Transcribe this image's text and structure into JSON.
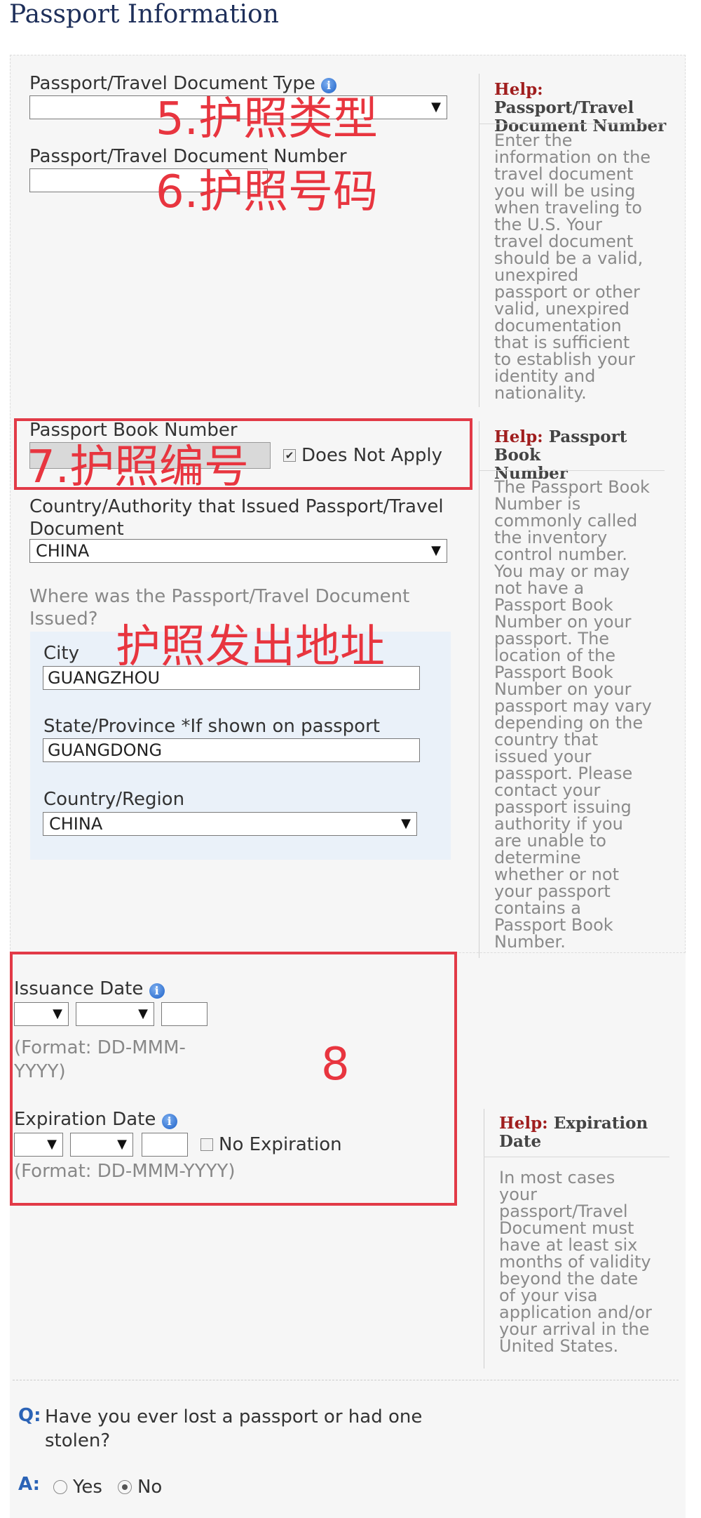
{
  "page": {
    "section_title": "Passport Information"
  },
  "fields": {
    "doc_type": {
      "label": "Passport/Travel Document Type",
      "value": ""
    },
    "doc_number": {
      "label": "Passport/Travel Document Number",
      "value": ""
    },
    "book_number": {
      "label": "Passport Book Number",
      "value": "",
      "does_not_apply_label": "Does Not Apply",
      "does_not_apply_checked": true
    },
    "issuing_country": {
      "label_line1": "Country/Authority that Issued Passport/Travel",
      "label_line2": "Document",
      "value": "CHINA"
    },
    "issued_where": {
      "question_line1": "Where was the Passport/Travel Document",
      "question_line2": "Issued?",
      "city": {
        "label": "City",
        "value": "GUANGZHOU"
      },
      "state": {
        "label": "State/Province *If shown on passport",
        "value": "GUANGDONG"
      },
      "country": {
        "label": "Country/Region",
        "value": "CHINA"
      }
    },
    "issuance_date": {
      "label": "Issuance Date",
      "format_line1": "(Format: DD-MMM-",
      "format_line2": "YYYY)"
    },
    "expiration_date": {
      "label": "Expiration Date",
      "format": "(Format: DD-MMM-YYYY)",
      "no_expiration_label": "No Expiration",
      "no_expiration_checked": false
    }
  },
  "help": {
    "doc_number": {
      "prefix": "Help:",
      "title_line1": "Passport/Travel",
      "title_line2": "Document Number",
      "body": [
        "Enter the",
        "information on the",
        "travel document",
        "you will be using",
        "when traveling to",
        "the U.S. Your",
        "travel document",
        "should be a valid,",
        "unexpired",
        "passport or other",
        "valid, unexpired",
        "documentation",
        "that is sufficient",
        "to establish your",
        "identity and",
        "nationality."
      ]
    },
    "book_number": {
      "prefix": "Help:",
      "title_line1": "Passport Book",
      "title_line2": "Number",
      "body": [
        "The Passport Book",
        "Number is",
        "commonly called",
        "the inventory",
        "control number.",
        "You may or may",
        "not have a",
        "Passport Book",
        "Number on your",
        "passport. The",
        "location of the",
        "Passport Book",
        "Number on your",
        "passport may vary",
        "depending on the",
        "country that",
        "issued your",
        "passport. Please",
        "contact your",
        "passport issuing",
        "authority if you",
        "are unable to",
        "determine",
        "whether or not",
        "your passport",
        "contains a",
        "Passport Book",
        "Number."
      ]
    },
    "expiration": {
      "prefix": "Help:",
      "title_line1": "Expiration",
      "title_line2": "Date",
      "body": [
        "In most cases",
        "your",
        "passport/Travel",
        "Document must",
        "have at least six",
        "months of validity",
        "beyond the date",
        "of your visa",
        "application and/or",
        "your arrival in the",
        "United States."
      ]
    }
  },
  "question": {
    "q_marker": "Q:",
    "text_line1": "Have you ever lost a passport or had one",
    "text_line2": "stolen?",
    "a_marker": "A:",
    "yes_label": "Yes",
    "no_label": "No",
    "selected": "No"
  },
  "annotations": {
    "a5": "5.护照类型",
    "a6": "6.护照号码",
    "a7": "7.护照编号",
    "issued_place": "护照发出地址",
    "a8": "8"
  },
  "icons": {
    "info": "info-icon",
    "dropdown": "chevron-down-icon"
  },
  "colors": {
    "annotation_red": "#e8353f",
    "help_title_red": "#a01e1e",
    "title_blue": "#1e2f5a",
    "q_blue": "#2b63b6"
  }
}
